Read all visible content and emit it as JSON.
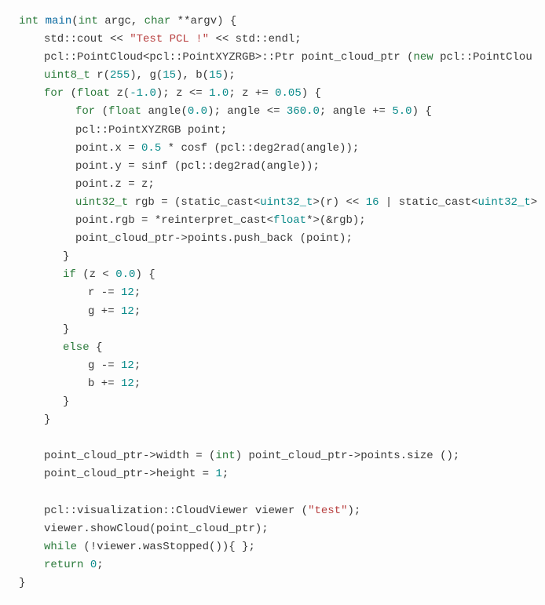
{
  "code": {
    "l1": {
      "kw1": "int",
      "fn": "main",
      "kw2": "int",
      "argc": " argc, ",
      "kw3": "char",
      "rest": " **argv) {"
    },
    "l2": {
      "a": "std::cout << ",
      "str": "\"Test PCL !\"",
      "b": " << std::endl;"
    },
    "l3": {
      "a": "pcl::PointCloud<pcl::PointXYZRGB>::Ptr point_cloud_ptr (",
      "kw": "new",
      "b": " pcl::PointClou"
    },
    "l4": {
      "t": "uint8_t",
      "a": " r(",
      "n1": "255",
      "b": "), g(",
      "n2": "15",
      "c": "), b(",
      "n3": "15",
      "d": ");"
    },
    "l5": {
      "kw": "for",
      "a": " (",
      "t": "float",
      "b": " z(",
      "n1": "-1.0",
      "c": "); z <= ",
      "n2": "1.0",
      "d": "; z += ",
      "n3": "0.05",
      "e": ") {"
    },
    "l6": {
      "kw": "for",
      "a": " (",
      "t": "float",
      "b": " angle(",
      "n1": "0.0",
      "c": "); angle <= ",
      "n2": "360.0",
      "d": "; angle += ",
      "n3": "5.0",
      "e": ") {"
    },
    "l7": {
      "a": "pcl::PointXYZRGB point;"
    },
    "l8": {
      "a": "point.x = ",
      "n": "0.5",
      "b": " * cosf (pcl::deg2rad(angle));"
    },
    "l9": {
      "a": "point.y = sinf (pcl::deg2rad(angle));"
    },
    "l10": {
      "a": "point.z = z;"
    },
    "l11": {
      "t": "uint32_t",
      "a": " rgb = (static_cast<",
      "t2": "uint32_t",
      "b": ">(r) << ",
      "n": "16",
      "c": " | static_cast<",
      "t3": "uint32_t",
      "d": ">"
    },
    "l12": {
      "a": "point.rgb = *reinterpret_cast<",
      "t": "float",
      "b": "*>(&rgb);"
    },
    "l13": {
      "a": "point_cloud_ptr->points.push_back (point);"
    },
    "l14": {
      "a": "}"
    },
    "l15": {
      "kw": "if",
      "a": " (z < ",
      "n": "0.0",
      "b": ") {"
    },
    "l16": {
      "a": "r -= ",
      "n": "12",
      "b": ";"
    },
    "l17": {
      "a": "g += ",
      "n": "12",
      "b": ";"
    },
    "l18": {
      "a": "}"
    },
    "l19": {
      "kw": "else",
      "a": " {"
    },
    "l20": {
      "a": "g -= ",
      "n": "12",
      "b": ";"
    },
    "l21": {
      "a": "b += ",
      "n": "12",
      "b": ";"
    },
    "l22": {
      "a": "}"
    },
    "l23": {
      "a": "}"
    },
    "l24": {
      "a": ""
    },
    "l25": {
      "a": "point_cloud_ptr->width = (",
      "kw": "int",
      "b": ") point_cloud_ptr->points.size ();"
    },
    "l26": {
      "a": "point_cloud_ptr->height = ",
      "n": "1",
      "b": ";"
    },
    "l27": {
      "a": ""
    },
    "l28": {
      "a": "pcl::visualization::CloudViewer viewer (",
      "str": "\"test\"",
      "b": ");"
    },
    "l29": {
      "a": "viewer.showCloud(point_cloud_ptr);"
    },
    "l30": {
      "kw": "while",
      "a": " (!viewer.wasStopped()){ };"
    },
    "l31": {
      "kw": "return",
      "a": " ",
      "n": "0",
      "b": ";"
    },
    "l32": {
      "a": "}"
    }
  }
}
